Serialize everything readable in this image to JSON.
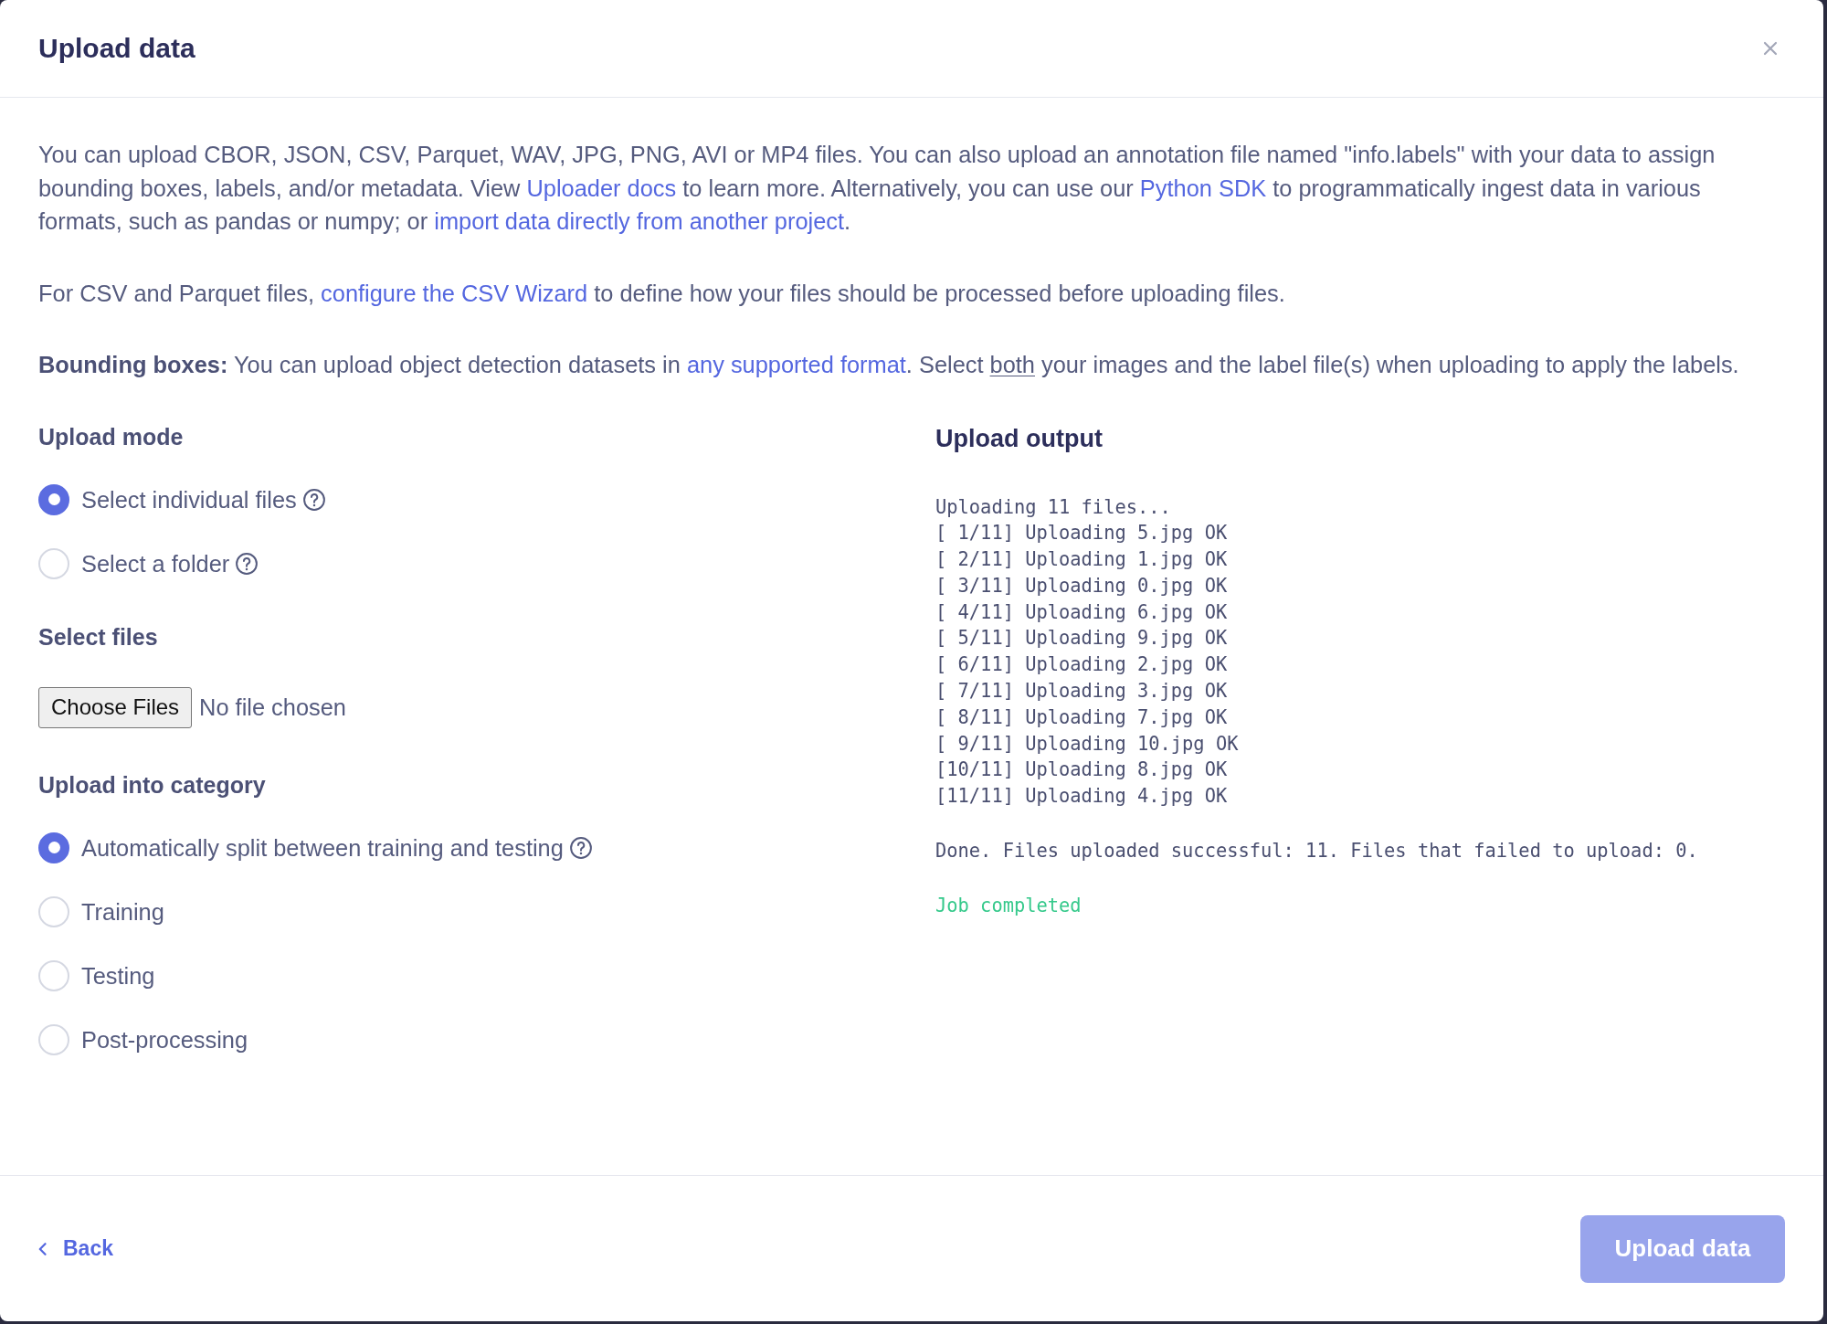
{
  "dialog": {
    "title": "Upload data"
  },
  "intro": [
    {
      "segments": [
        {
          "kind": "text",
          "text": "You can upload CBOR, JSON, CSV, Parquet, WAV, JPG, PNG, AVI or MP4 files. You can also upload an annotation file named \"info.labels\" with your data to assign bounding boxes, labels, and/or metadata. View "
        },
        {
          "kind": "link",
          "text": "Uploader docs"
        },
        {
          "kind": "text",
          "text": " to learn more. Alternatively, you can use our "
        },
        {
          "kind": "link",
          "text": "Python SDK"
        },
        {
          "kind": "text",
          "text": " to programmatically ingest data in various formats, such as pandas or numpy; or "
        },
        {
          "kind": "link",
          "text": "import data directly from another project"
        },
        {
          "kind": "text",
          "text": "."
        }
      ]
    },
    {
      "segments": [
        {
          "kind": "text",
          "text": "For CSV and Parquet files, "
        },
        {
          "kind": "link",
          "text": "configure the CSV Wizard"
        },
        {
          "kind": "text",
          "text": " to define how your files should be processed before uploading files."
        }
      ]
    },
    {
      "segments": [
        {
          "kind": "bold",
          "text": "Bounding boxes:"
        },
        {
          "kind": "text",
          "text": " You can upload object detection datasets in "
        },
        {
          "kind": "link",
          "text": "any supported format"
        },
        {
          "kind": "text",
          "text": ". Select "
        },
        {
          "kind": "underline",
          "text": "both"
        },
        {
          "kind": "text",
          "text": " your images and the label file(s) when uploading to apply the labels."
        }
      ]
    }
  ],
  "upload_mode": {
    "label": "Upload mode",
    "options": [
      {
        "label": "Select individual files",
        "selected": true,
        "help": true
      },
      {
        "label": "Select a folder",
        "selected": false,
        "help": true
      }
    ]
  },
  "select_files": {
    "label": "Select files",
    "button": "Choose Files",
    "status": "No file chosen"
  },
  "category": {
    "label": "Upload into category",
    "options": [
      {
        "label": "Automatically split between training and testing",
        "selected": true,
        "help": true
      },
      {
        "label": "Training",
        "selected": false,
        "help": false
      },
      {
        "label": "Testing",
        "selected": false,
        "help": false
      },
      {
        "label": "Post-processing",
        "selected": false,
        "help": false
      }
    ]
  },
  "output": {
    "title": "Upload output",
    "blocks": [
      {
        "kind": "log",
        "lines": [
          "Uploading 11 files...",
          "[ 1/11] Uploading 5.jpg OK",
          "[ 2/11] Uploading 1.jpg OK",
          "[ 3/11] Uploading 0.jpg OK",
          "[ 4/11] Uploading 6.jpg OK",
          "[ 5/11] Uploading 9.jpg OK",
          "[ 6/11] Uploading 2.jpg OK",
          "[ 7/11] Uploading 3.jpg OK",
          "[ 8/11] Uploading 7.jpg OK",
          "[ 9/11] Uploading 10.jpg OK",
          "[10/11] Uploading 8.jpg OK",
          "[11/11] Uploading 4.jpg OK"
        ]
      },
      {
        "kind": "log",
        "lines": [
          "Done. Files uploaded successful: 11. Files that failed to upload: 0."
        ]
      },
      {
        "kind": "success",
        "lines": [
          "Job completed"
        ]
      }
    ]
  },
  "footer": {
    "back": "Back",
    "submit": {
      "label": "Upload data",
      "disabled": true
    }
  }
}
